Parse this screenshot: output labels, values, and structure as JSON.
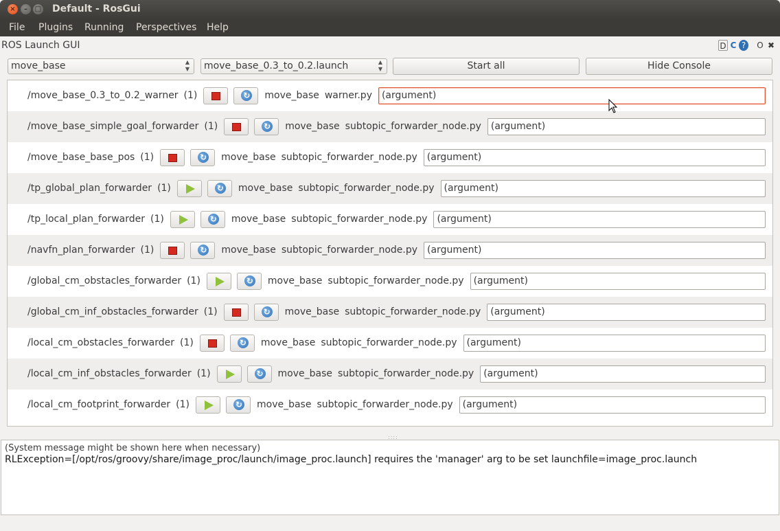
{
  "window": {
    "title": "Default - RosGui",
    "close_glyph": "×",
    "min_glyph": "–",
    "max_glyph": "□"
  },
  "menubar": [
    "File",
    "Plugins",
    "Running",
    "Perspectives",
    "Help"
  ],
  "plugin": {
    "title": "ROS Launch GUI",
    "dock_icons": [
      "D",
      "C",
      "?",
      "O",
      "✖"
    ]
  },
  "toolbar": {
    "package_select": "move_base",
    "launchfile_select": "move_base_0.3_to_0.2.launch",
    "start_all_label": "Start all",
    "hide_console_label": "Hide Console"
  },
  "nodes": [
    {
      "name": "/move_base_0.3_to_0.2_warner",
      "count": "(1)",
      "state": "running",
      "package": "move_base",
      "file": "warner.py",
      "argument": "(argument)",
      "focused": true
    },
    {
      "name": "/move_base_simple_goal_forwarder",
      "count": "(1)",
      "state": "running",
      "package": "move_base",
      "file": "subtopic_forwarder_node.py",
      "argument": "(argument)"
    },
    {
      "name": "/move_base_base_pos",
      "count": "(1)",
      "state": "running",
      "package": "move_base",
      "file": "subtopic_forwarder_node.py",
      "argument": "(argument)"
    },
    {
      "name": "/tp_global_plan_forwarder",
      "count": "(1)",
      "state": "stopped",
      "package": "move_base",
      "file": "subtopic_forwarder_node.py",
      "argument": "(argument)"
    },
    {
      "name": "/tp_local_plan_forwarder",
      "count": "(1)",
      "state": "stopped",
      "package": "move_base",
      "file": "subtopic_forwarder_node.py",
      "argument": "(argument)"
    },
    {
      "name": "/navfn_plan_forwarder",
      "count": "(1)",
      "state": "running",
      "package": "move_base",
      "file": "subtopic_forwarder_node.py",
      "argument": "(argument)"
    },
    {
      "name": "/global_cm_obstacles_forwarder",
      "count": "(1)",
      "state": "stopped",
      "package": "move_base",
      "file": "subtopic_forwarder_node.py",
      "argument": "(argument)"
    },
    {
      "name": "/global_cm_inf_obstacles_forwarder",
      "count": "(1)",
      "state": "running",
      "package": "move_base",
      "file": "subtopic_forwarder_node.py",
      "argument": "(argument)"
    },
    {
      "name": "/local_cm_obstacles_forwarder",
      "count": "(1)",
      "state": "running",
      "package": "move_base",
      "file": "subtopic_forwarder_node.py",
      "argument": "(argument)"
    },
    {
      "name": "/local_cm_inf_obstacles_forwarder",
      "count": "(1)",
      "state": "stopped",
      "package": "move_base",
      "file": "subtopic_forwarder_node.py",
      "argument": "(argument)"
    },
    {
      "name": "/local_cm_footprint_forwarder",
      "count": "(1)",
      "state": "stopped",
      "package": "move_base",
      "file": "subtopic_forwarder_node.py",
      "argument": "(argument)"
    }
  ],
  "console": {
    "hint": "(System message might be shown here when necessary)",
    "message": "RLException=[/opt/ros/groovy/share/image_proc/launch/image_proc.launch] requires the 'manager' arg to be set launchfile=image_proc.launch"
  },
  "colors": {
    "stop": "#d42a20",
    "start": "#8fc23a",
    "focus_border": "#e0552f"
  }
}
